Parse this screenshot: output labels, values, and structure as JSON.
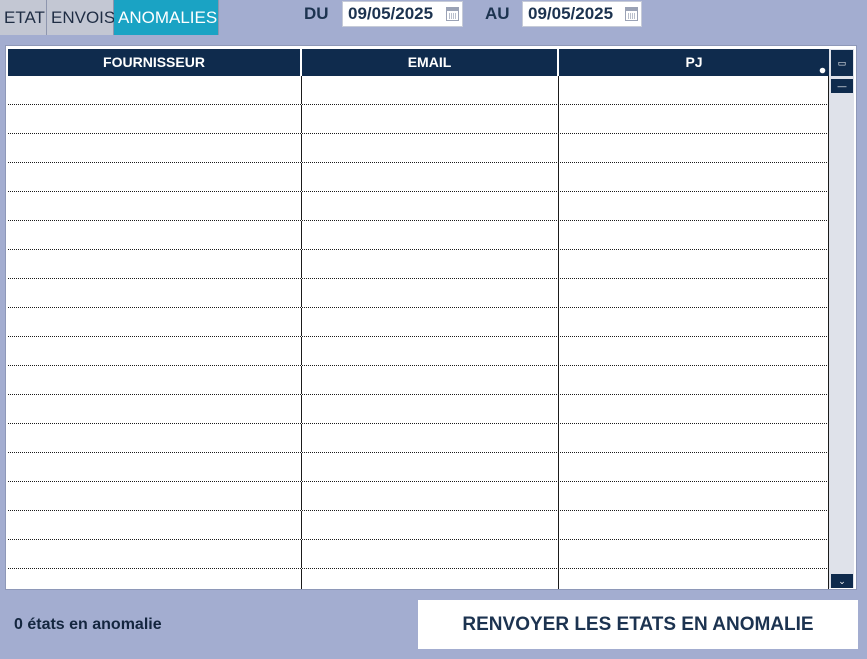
{
  "tabs": [
    {
      "label": "ETAT",
      "active": false
    },
    {
      "label": "ENVOIS",
      "active": false
    },
    {
      "label": "ANOMALIES",
      "active": true
    }
  ],
  "filters": {
    "from_label": "DU",
    "from_value": "09/05/2025",
    "to_label": "AU",
    "to_value": "09/05/2025"
  },
  "table": {
    "columns": [
      "FOURNISSEUR",
      "EMAIL",
      "PJ"
    ],
    "empty_row_count": 18
  },
  "footer": {
    "count_text": "0 états en anomalie",
    "action_label": "RENVOYER LES ETATS EN ANOMALIE"
  },
  "colors": {
    "background": "#a3add0",
    "header": "#0f2b4d",
    "active_tab": "#1aa3c4"
  }
}
